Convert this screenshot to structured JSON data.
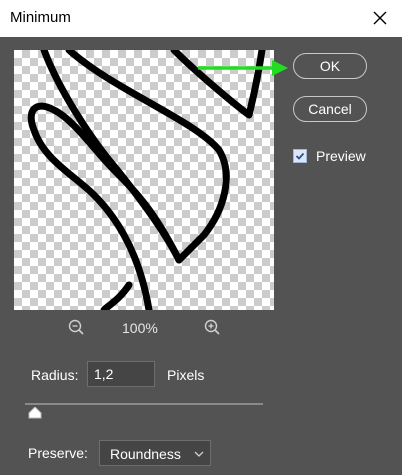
{
  "window": {
    "title": "Minimum"
  },
  "buttons": {
    "ok": "OK",
    "cancel": "Cancel"
  },
  "preview": {
    "label": "Preview",
    "checked": true
  },
  "zoom": {
    "level": "100%"
  },
  "radius": {
    "label": "Radius:",
    "value": "1,2",
    "unit": "Pixels",
    "slider_fraction": 0.04
  },
  "preserve": {
    "label": "Preserve:",
    "value": "Roundness"
  },
  "colors": {
    "background": "#535353",
    "arrow": "#22dd22",
    "checkbox_fill": "#dbe6f7"
  },
  "icons": [
    "close-icon",
    "zoom-out-icon",
    "zoom-in-icon",
    "checkmark-icon",
    "chevron-down-icon",
    "arrow-icon"
  ]
}
